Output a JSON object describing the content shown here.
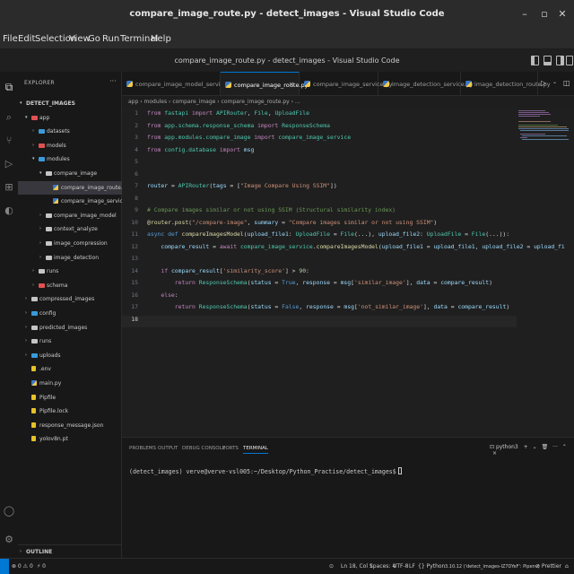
{
  "window": {
    "title": "compare_image_route.py - detect_images - Visual Studio Code",
    "controls": [
      "–",
      "▫",
      "✕"
    ]
  },
  "menu": [
    "File",
    "Edit",
    "Selection",
    "View",
    "Go",
    "Run",
    "Terminal",
    "Help"
  ],
  "vscode_title": "compare_image_route.py - detect_images - Visual Studio Code",
  "explorer": {
    "header": "EXPLORER",
    "more": "···",
    "root": "DETECT_IMAGES",
    "items": [
      {
        "label": "app",
        "kind": "folder-open",
        "color": "#e05252"
      },
      {
        "label": "datasets",
        "kind": "folder",
        "color": "#3a9ad9"
      },
      {
        "label": "models",
        "kind": "folder",
        "color": "#e05252"
      },
      {
        "label": "modules",
        "kind": "folder-open",
        "color": "#3a9ad9"
      },
      {
        "label": "compare_image",
        "kind": "folder-open",
        "color": "#c5c5c5"
      },
      {
        "label": "compare_image_route.py",
        "kind": "py"
      },
      {
        "label": "compare_image_service.py",
        "kind": "py"
      },
      {
        "label": "compare_image_model",
        "kind": "folder",
        "color": "#c5c5c5"
      },
      {
        "label": "context_analyze",
        "kind": "folder",
        "color": "#c5c5c5"
      },
      {
        "label": "image_compression",
        "kind": "folder",
        "color": "#c5c5c5"
      },
      {
        "label": "image_detection",
        "kind": "folder",
        "color": "#c5c5c5"
      },
      {
        "label": "runs",
        "kind": "folder",
        "color": "#c5c5c5"
      },
      {
        "label": "schema",
        "kind": "folder",
        "color": "#e05252"
      },
      {
        "label": "compressed_images",
        "kind": "folder",
        "color": "#c5c5c5"
      },
      {
        "label": "config",
        "kind": "folder",
        "color": "#3a9ad9"
      },
      {
        "label": "predicted_images",
        "kind": "folder",
        "color": "#c5c5c5"
      },
      {
        "label": "runs",
        "kind": "folder",
        "color": "#c5c5c5"
      },
      {
        "label": "uploads",
        "kind": "folder",
        "color": "#3a9ad9"
      },
      {
        "label": ".env",
        "kind": "file",
        "color": "#e6c229"
      },
      {
        "label": "main.py",
        "kind": "py"
      },
      {
        "label": "Pipfile",
        "kind": "file",
        "color": "#e6c229"
      },
      {
        "label": "Pipfile.lock",
        "kind": "file",
        "color": "#e6c229"
      },
      {
        "label": "response_message.json",
        "kind": "file",
        "color": "#e6c229"
      },
      {
        "label": "yolov8n.pt",
        "kind": "file",
        "color": "#e6c229"
      }
    ],
    "outline": "OUTLINE"
  },
  "tabs": [
    {
      "label": "compare_image_model_service.py",
      "active": false
    },
    {
      "label": "compare_image_route.py",
      "active": true
    },
    {
      "label": "compare_image_service.py",
      "active": false
    },
    {
      "label": "image_detection_service.py",
      "active": false
    },
    {
      "label": "image_detection_route.py",
      "active": false
    }
  ],
  "breadcrumb": "app › modules › compare_image › compare_image_route.py › ...",
  "code": {
    "line_numbers": [
      "1",
      "2",
      "3",
      "4",
      "5",
      "6",
      "7",
      "8",
      "9",
      "10",
      "11",
      "12",
      "13",
      "14",
      "15",
      "16",
      "17",
      "18"
    ],
    "lines": [
      "from fastapi import APIRouter, File, UploadFile",
      "from app.schema.response_schema import ResponseSchema",
      "from app.modules.compare_image import compare_image_service",
      "from config.database import msg",
      "",
      "",
      "router = APIRouter(tags = [\"Image Compare Using SSIM\"])",
      "",
      "# Compare images similar or not using SSIM (Structural similarity index)",
      "@router.post(\"/compare-image\", summary = \"Compare images similar or not using SSIM\")",
      "async def compareImagesModel(upload_file1: UploadFile = File(...), upload_file2: UploadFile = File(...)):",
      "    compare_result = await compare_image_service.compareImagesModel(upload_file1 = upload_file1, upload_file2 = upload_fi",
      "",
      "    if compare_result['similarity_score'] > 90:",
      "        return ResponseSchema(status = True, response = msg['similar_image'], data = compare_result)",
      "    else:",
      "        return ResponseSchema(status = False, response = msg['not_similar_image'], data = compare_result)",
      ""
    ]
  },
  "panel": {
    "tabs": [
      "PROBLEMS",
      "OUTPUT",
      "DEBUG CONSOLE",
      "PORTS",
      "TERMINAL"
    ],
    "active": "TERMINAL",
    "shell": "python3",
    "terminal_line": "(detect_images) verve@verve-vsl005:~/Desktop/Python_Practise/detect_images$"
  },
  "status": {
    "left": [
      "⊗ 0 ⚠ 0",
      "⚡ 0"
    ],
    "right": [
      "Ln 18, Col 1",
      "Spaces: 4",
      "UTF-8",
      "LF",
      "{} Python",
      "3.10.12 ('detect_images-IZ7DYeF': Pipenv)",
      "⊘ Prettier"
    ]
  },
  "colors": {
    "accent": "#0078d4",
    "editor_bg": "#1f1f1f",
    "sidebar_bg": "#181818"
  }
}
